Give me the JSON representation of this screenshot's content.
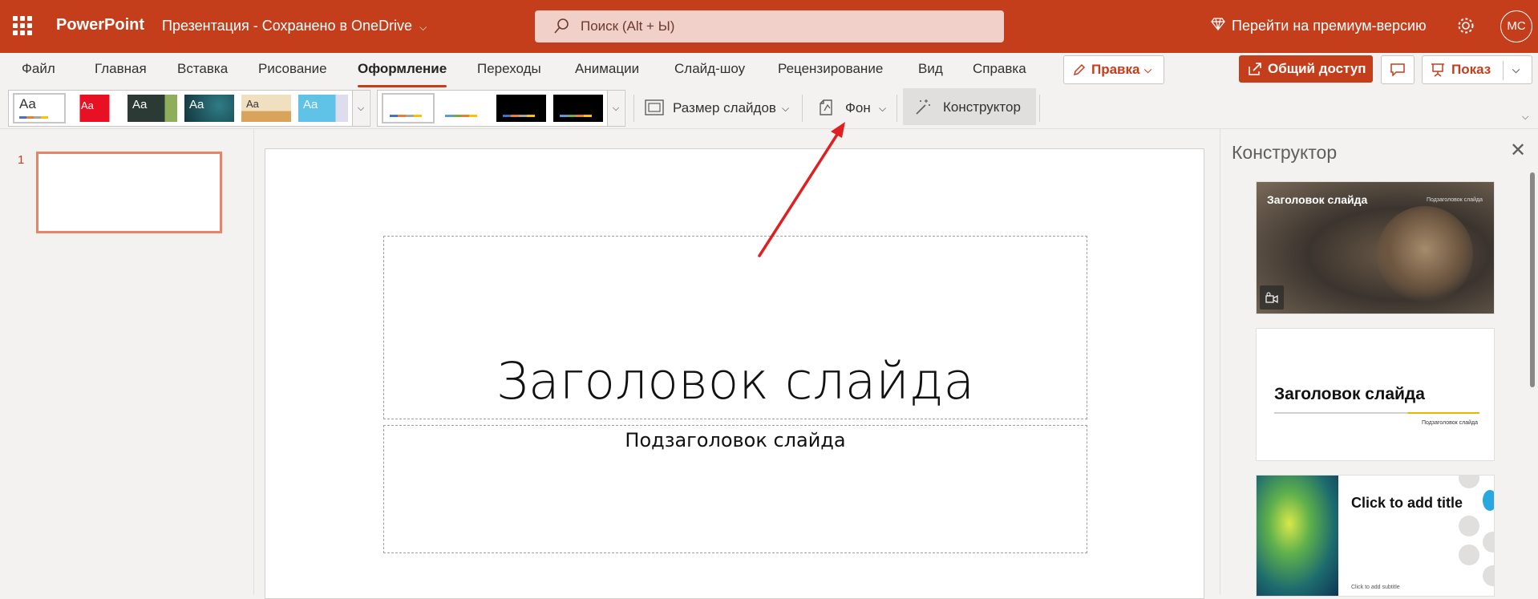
{
  "app": {
    "name": "PowerPoint",
    "document_title": "Презентация",
    "save_status": "Сохранено в OneDrive"
  },
  "search": {
    "placeholder": "Поиск (Alt + Ы)"
  },
  "header": {
    "premium": "Перейти на премиум-версию",
    "user_initials": "МС"
  },
  "menu": {
    "tabs": [
      "Файл",
      "Главная",
      "Вставка",
      "Рисование",
      "Оформление",
      "Переходы",
      "Анимации",
      "Слайд-шоу",
      "Рецензирование",
      "Вид",
      "Справка"
    ],
    "active_tab": "Оформление",
    "edit_mode": "Правка",
    "share": "Общий доступ",
    "show": "Показ"
  },
  "ribbon": {
    "slide_size": "Размер слайдов",
    "background": "Фон",
    "designer": "Конструктор"
  },
  "thumbnails": {
    "slide_number": "1"
  },
  "slide": {
    "title": "Заголовок слайда",
    "subtitle": "Подзаголовок слайда"
  },
  "designer_pane": {
    "title": "Конструктор",
    "cards": [
      {
        "title": "Заголовок слайда",
        "subtitle": "Подзаголовок слайда"
      },
      {
        "title": "Заголовок слайда",
        "subtitle": "Подзаголовок слайда"
      },
      {
        "title": "Click to add title",
        "subtitle": "Click to add subtitle"
      }
    ]
  },
  "colors": {
    "accent": "#c43e1c",
    "annotation_arrow": "#e02020"
  }
}
